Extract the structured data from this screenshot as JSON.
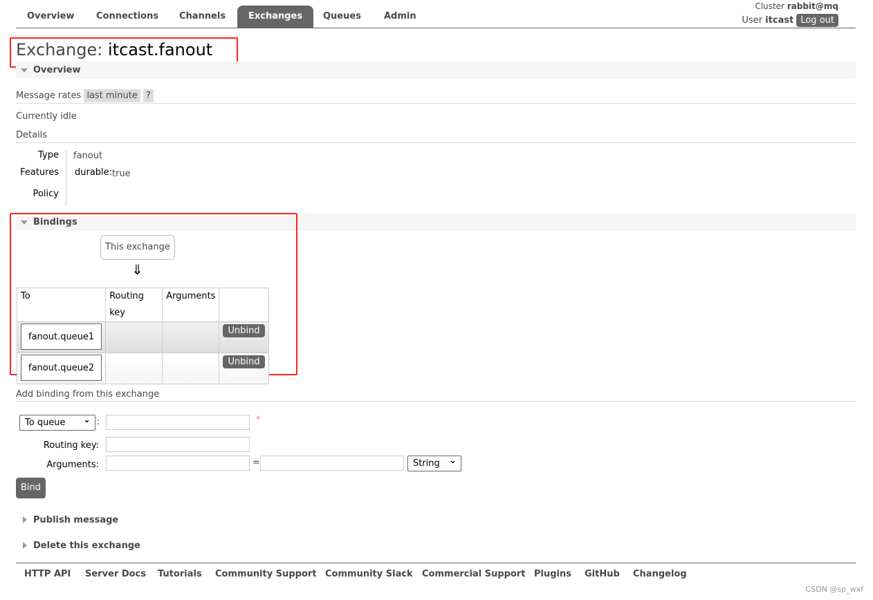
{
  "nav": {
    "tabs": [
      "Overview",
      "Connections",
      "Channels",
      "Exchanges",
      "Queues",
      "Admin"
    ],
    "active": "Exchanges",
    "cluster_label": "Cluster",
    "cluster": "rabbit@mq",
    "user_label": "User",
    "user": "itcast",
    "logout": "Log out"
  },
  "title": {
    "prefix": "Exchange:",
    "name": "itcast.fanout"
  },
  "overview": {
    "heading": "Overview",
    "rates_label": "Message rates",
    "rates_period": "last minute",
    "help": "?",
    "status": "Currently idle",
    "details_label": "Details",
    "type_label": "Type",
    "type": "fanout",
    "features_label": "Features",
    "feature_key": "durable:",
    "feature_value": "true",
    "policy_label": "Policy"
  },
  "bindings": {
    "heading": "Bindings",
    "source": "This exchange",
    "arrow": "⇓",
    "columns": [
      "To",
      "Routing key",
      "Arguments",
      ""
    ],
    "rows": [
      {
        "to": "fanout.queue1",
        "routing_key": "",
        "arguments": "",
        "action": "Unbind"
      },
      {
        "to": "fanout.queue2",
        "routing_key": "",
        "arguments": "",
        "action": "Unbind"
      }
    ]
  },
  "add_binding": {
    "heading": "Add binding from this exchange",
    "destination_type": "To queue",
    "required_mark": "*",
    "routing_key_label": "Routing key:",
    "arguments_label": "Arguments:",
    "equals": "=",
    "arg_type": "String",
    "bind": "Bind"
  },
  "collapsed": [
    "Publish message",
    "Delete this exchange"
  ],
  "footer": [
    "HTTP API",
    "Server Docs",
    "Tutorials",
    "Community Support",
    "Community Slack",
    "Commercial Support",
    "Plugins",
    "GitHub",
    "Changelog"
  ],
  "watermark": "CSDN @sp_wxf",
  "colors": {
    "highlight": "#ff2222",
    "accent": "#666666"
  }
}
